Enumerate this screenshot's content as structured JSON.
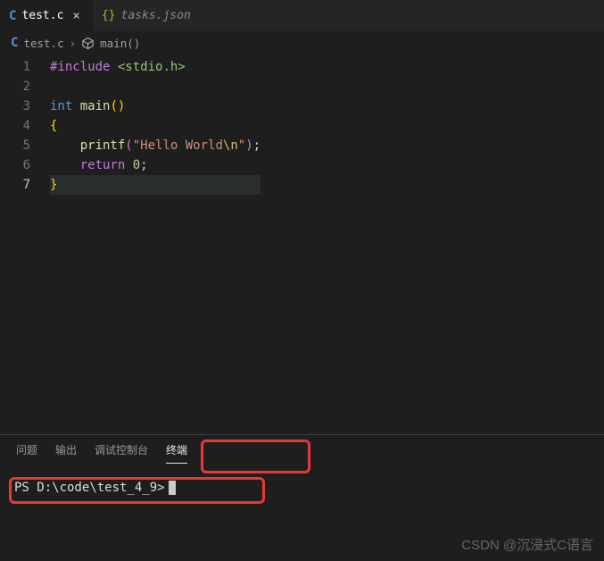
{
  "tabs": {
    "active": {
      "icon": "C",
      "label": "test.c"
    },
    "inactive": {
      "icon": "{}",
      "label": "tasks.json"
    }
  },
  "breadcrumb": {
    "file_icon": "C",
    "file": "test.c",
    "symbol": "main()"
  },
  "gutter": [
    "1",
    "2",
    "3",
    "4",
    "5",
    "6",
    "7"
  ],
  "code": {
    "l1_kw": "#include",
    "l1_inc": " <stdio.h>",
    "l3_type": "int",
    "l3_fn": " main",
    "l3_paren": "()",
    "l4_brace": "{",
    "l5_indent": "    ",
    "l5_fn": "printf",
    "l5_p1": "(",
    "l5_q1": "\"",
    "l5_str": "Hello World",
    "l5_esc": "\\n",
    "l5_q2": "\"",
    "l5_p2": ")",
    "l5_semi": ";",
    "l6_indent": "    ",
    "l6_kw": "return",
    "l6_sp": " ",
    "l6_num": "0",
    "l6_semi": ";",
    "l7_brace": "}"
  },
  "panel": {
    "tabs": {
      "problems": "问题",
      "output": "输出",
      "debug": "调试控制台",
      "terminal": "终端"
    },
    "prompt": "PS D:\\code\\test_4_9>"
  },
  "watermark": "CSDN @沉浸式C语言"
}
